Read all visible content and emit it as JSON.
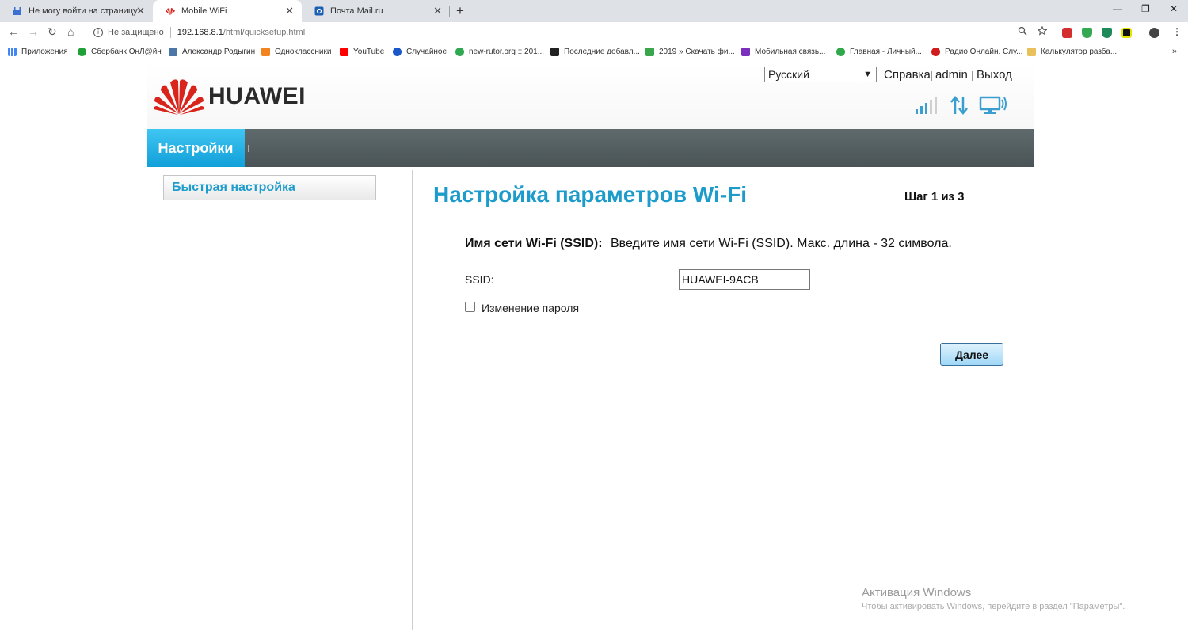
{
  "browser": {
    "tabs": [
      {
        "title": "Не могу войти на страницу нас",
        "close": "✕"
      },
      {
        "title": "Mobile WiFi",
        "close": "✕"
      },
      {
        "title": "Почта Mail.ru",
        "close": "✕"
      }
    ],
    "new_tab": "+",
    "window_controls": {
      "minimize": "—",
      "maximize": "❐",
      "close": "✕"
    },
    "nav": {
      "back": "←",
      "forward": "→",
      "reload": "↻",
      "home": "⌂"
    },
    "security_label": "Не защищено",
    "url_host": "192.168.8.1",
    "url_path": "/html/quicksetup.html",
    "bookmarks": [
      "Приложения",
      "Сбербанк ОнЛ@йн",
      "Александр Родыгин",
      "Одноклассники",
      "YouTube",
      "Случайное",
      "new-rutor.org :: 201...",
      "Последние добавл...",
      "2019 » Скачать фи...",
      "Мобильная связь...",
      "Главная - Личный...",
      "Радио Онлайн. Слу...",
      "Калькулятор разба..."
    ],
    "bookmarks_more": "»",
    "colors": {
      "tabstrip": "#dee1e6",
      "accent": "#1d9ccc"
    }
  },
  "router": {
    "brand": "HUAWEI",
    "language": "Русский",
    "links": {
      "help": "Справка",
      "user": "admin",
      "logout": "Выход"
    },
    "menu": {
      "settings": "Настройки"
    },
    "sidebar": {
      "quick_setup": "Быстрая настройка"
    },
    "content": {
      "title": "Настройка параметров Wi-Fi",
      "step": "Шаг 1 из 3",
      "ssid_heading": "Имя сети Wi-Fi (SSID):",
      "ssid_hint": "Введите имя сети Wi-Fi (SSID). Макс. длина - 32 символа.",
      "ssid_label": "SSID:",
      "ssid_value": "HUAWEI-9ACB",
      "change_password": "Изменение пароля",
      "change_password_checked": false,
      "next": "Далее"
    },
    "colors": {
      "title_blue": "#1d9ccc",
      "menu_active": "#119fd9",
      "menubar": "#4a5456"
    }
  },
  "watermark": {
    "title": "Активация Windows",
    "subtitle": "Чтобы активировать Windows, перейдите в раздел \"Параметры\"."
  }
}
